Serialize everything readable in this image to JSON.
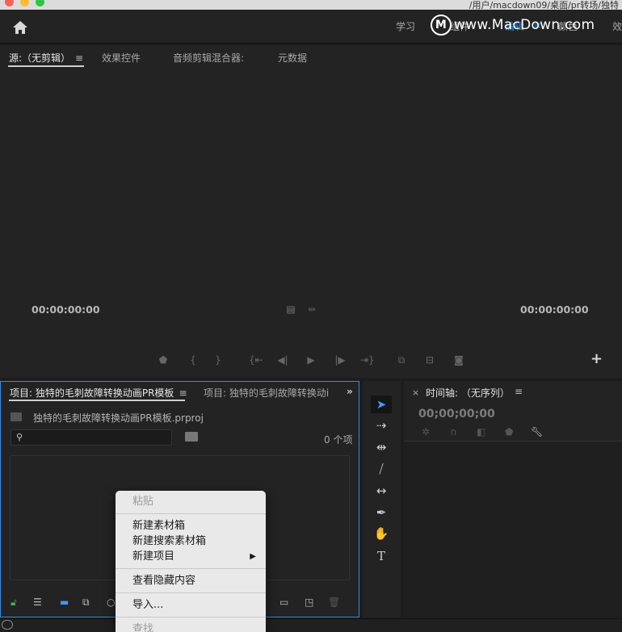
{
  "window": {
    "path": "/用户/macdown09/桌面/pr转场/独特"
  },
  "watermark": {
    "logo": "M",
    "text": "www.MacDown.com"
  },
  "workspaces": {
    "items": [
      "学习",
      "组件",
      "编辑",
      "颜色",
      "效"
    ],
    "active": "编辑",
    "menu_glyph": "≡"
  },
  "source_panel": {
    "tabs": [
      "源:（无剪辑）",
      "效果控件",
      "音频剪辑混合器:",
      "元数据"
    ],
    "menu_glyph": "≡",
    "timecode_left": "00:00:00:00",
    "timecode_right": "00:00:00:00",
    "add_button": "+"
  },
  "project_panel": {
    "tab_active": "项目: 独特的毛刺故障转换动画PR模板",
    "tab_inactive": "项目: 独特的毛刺故障转换动i",
    "menu_glyph": "≡",
    "overflow": "»",
    "file_name": "独特的毛刺故障转换动画PR模板.prproj",
    "search_placeholder": "",
    "item_count": "0 个项"
  },
  "timeline_panel": {
    "close": "×",
    "title": "时间轴: （无序列）",
    "menu_glyph": "≡",
    "timecode": "00;00;00;00"
  },
  "context_menu": {
    "items": [
      {
        "label": "粘贴",
        "disabled": true
      },
      {
        "separator": true
      },
      {
        "label": "新建素材箱",
        "disabled": false
      },
      {
        "label": "新建搜索素材箱",
        "disabled": false
      },
      {
        "label": "新建项目",
        "disabled": false,
        "submenu": true
      },
      {
        "separator": true
      },
      {
        "label": "查看隐藏内容",
        "disabled": false
      },
      {
        "separator": true
      },
      {
        "label": "导入...",
        "disabled": false
      },
      {
        "separator": true
      },
      {
        "label": "查找",
        "disabled": true
      }
    ]
  },
  "colors": {
    "accent": "#2d8ceb",
    "panel_bg": "#232323",
    "menu_bg": "#e9e9e9"
  }
}
